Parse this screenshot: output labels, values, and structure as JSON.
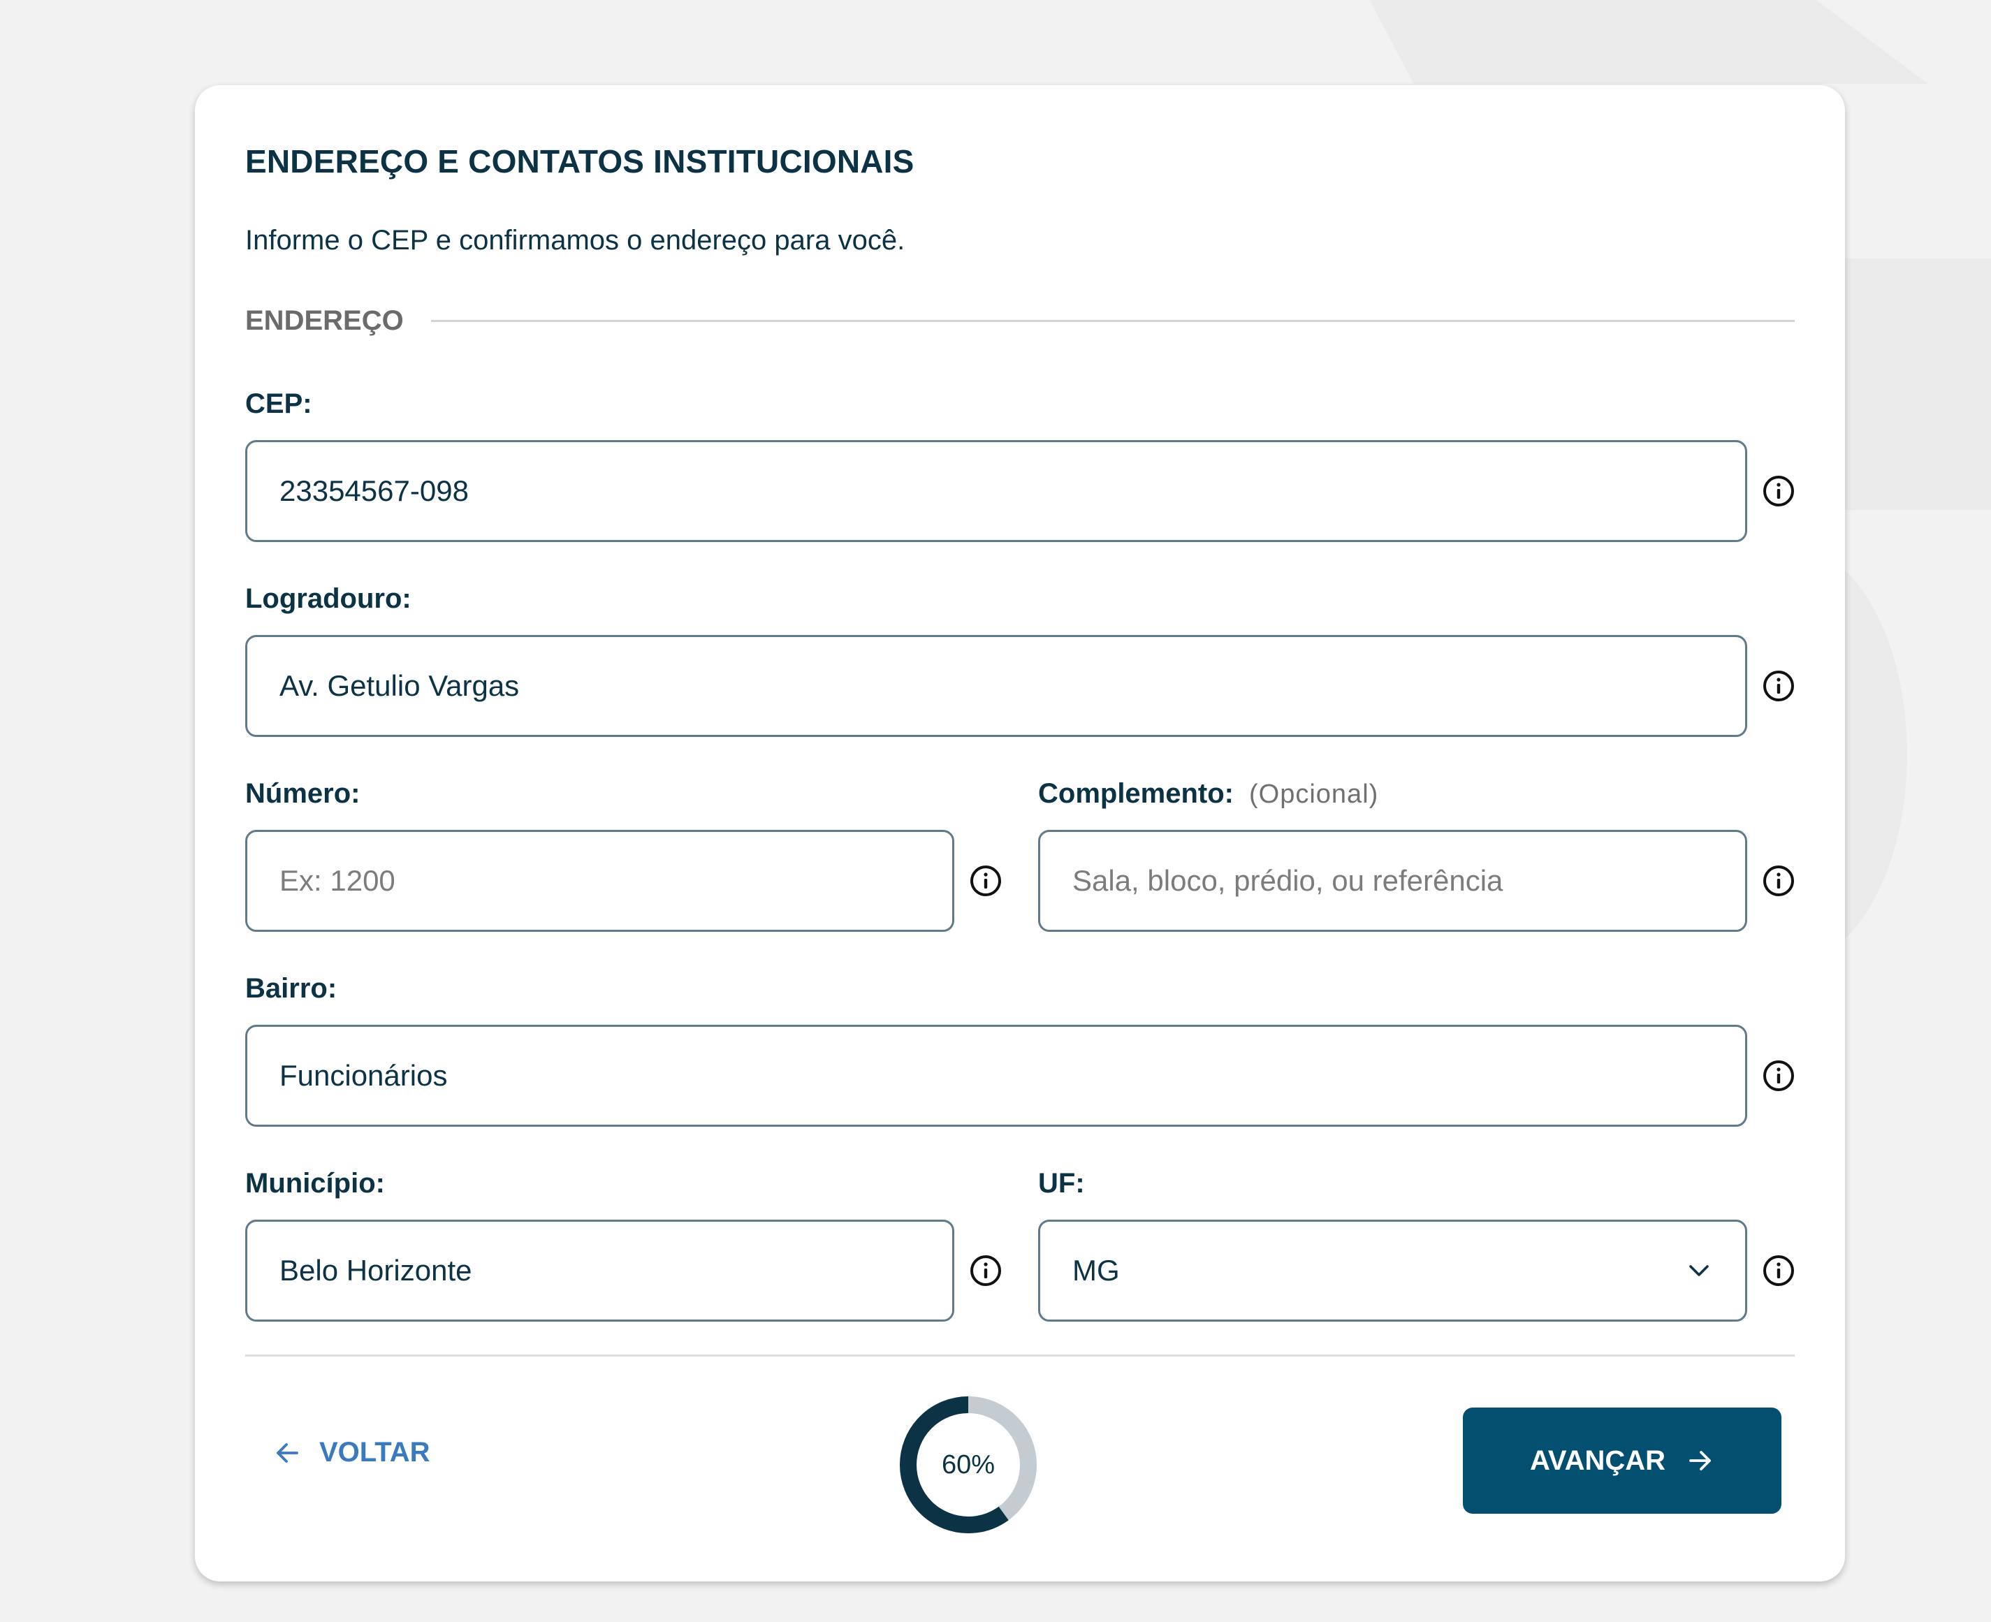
{
  "form": {
    "title": "ENDEREÇO E CONTATOS INSTITUCIONAIS",
    "subtitle": "Informe o CEP e confirmamos o endereço para você.",
    "section_label": "ENDEREÇO"
  },
  "fields": {
    "cep": {
      "label": "CEP:",
      "value": "23354567-098"
    },
    "logradouro": {
      "label": "Logradouro:",
      "value": "Av. Getulio Vargas"
    },
    "numero": {
      "label": "Número:",
      "value": "",
      "placeholder": "Ex: 1200"
    },
    "complemento": {
      "label": "Complemento:",
      "optional": "(Opcional)",
      "value": "",
      "placeholder": "Sala, bloco, prédio, ou referência"
    },
    "bairro": {
      "label": "Bairro:",
      "value": "Funcionários"
    },
    "municipio": {
      "label": "Município:",
      "value": "Belo Horizonte"
    },
    "uf": {
      "label": "UF:",
      "value": "MG"
    }
  },
  "footer": {
    "back_label": "VOLTAR",
    "next_label": "AVANÇAR",
    "progress_percent": 60,
    "progress_text": "60%"
  },
  "icons": {
    "info": "info-circle-icon",
    "chevron": "chevron-down-icon",
    "back": "arrow-left-icon",
    "next": "arrow-right-icon"
  },
  "colors": {
    "primary": "#024f6f",
    "text": "#0b3345",
    "link": "#3a7bc0",
    "border": "#5f7b89",
    "progress_track": "#c4ccd1",
    "progress_fill": "#0b3345"
  }
}
